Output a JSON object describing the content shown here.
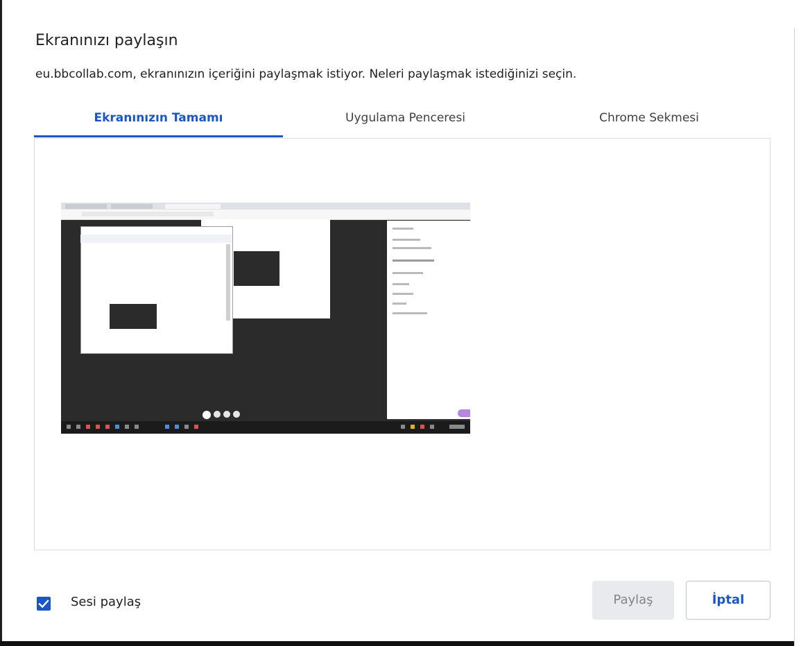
{
  "dialog": {
    "title": "Ekranınızı paylaşın",
    "subtitle": "eu.bbcollab.com, ekranınızın içeriğini paylaşmak istiyor. Neleri paylaşmak istediğinizi seçin."
  },
  "tabs": [
    {
      "label": "Ekranınızın Tamamı",
      "active": true
    },
    {
      "label": "Uygulama Penceresi",
      "active": false
    },
    {
      "label": "Chrome Sekmesi",
      "active": false
    }
  ],
  "audio": {
    "label": "Sesi paylaş",
    "checked": true
  },
  "buttons": {
    "share_label": "Paylaş",
    "share_enabled": false,
    "cancel_label": "İptal"
  },
  "colors": {
    "accent": "#1a56c4",
    "disabled_button_bg": "#e8eaed",
    "border": "#dadce0"
  },
  "icons": {
    "checkbox": "checkmark-icon"
  }
}
